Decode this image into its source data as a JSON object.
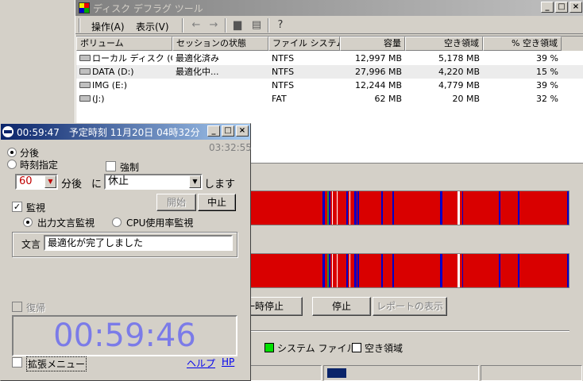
{
  "defrag": {
    "title": "ディスク デフラグ ツール",
    "menu": {
      "action": "操作(A)",
      "view": "表示(V)"
    },
    "columns": {
      "volume": "ボリューム",
      "session": "セッションの状態",
      "filesystem": "ファイル システム",
      "capacity": "容量",
      "free": "空き領域",
      "pct_free": "% 空き領域"
    },
    "volumes": [
      {
        "name": "ローカル ディスク (C:)",
        "status": "最適化済み",
        "fs": "NTFS",
        "capacity": "12,997 MB",
        "free": "5,178 MB",
        "pct": "39 %"
      },
      {
        "name": "DATA (D:)",
        "status": "最適化中...",
        "fs": "NTFS",
        "capacity": "27,996 MB",
        "free": "4,220 MB",
        "pct": "15 %"
      },
      {
        "name": "IMG (E:)",
        "status": "",
        "fs": "NTFS",
        "capacity": "12,244 MB",
        "free": "4,779 MB",
        "pct": "39 %"
      },
      {
        "name": "(J:)",
        "status": "",
        "fs": "FAT",
        "capacity": "62 MB",
        "free": "20 MB",
        "pct": "32 %"
      }
    ],
    "buttons": {
      "pause": "一時停止",
      "stop": "停止",
      "report": "レポートの表示"
    },
    "legend": {
      "system": "システム ファイル",
      "free": "空き領域"
    },
    "colors": {
      "fragmented": "#d90000",
      "contiguous": "#0000c8",
      "unmovable": "#2f8f2f",
      "free": "#ffffff",
      "system": "#00e000"
    }
  },
  "timer": {
    "title": "00:59:47　予定時刻 11月20日 04時32分",
    "elapsed": "03:32:55",
    "mode_after": "分後",
    "mode_time": "時刻指定",
    "force": "強制",
    "minutes": "60",
    "minutes_unit": "分後",
    "ni": "に",
    "action": "休止",
    "shimasu": "します",
    "start": "開始",
    "cancel": "中止",
    "monitor": "監視",
    "monitor_output": "出力文言監視",
    "monitor_cpu": "CPU使用率監視",
    "text_label": "文言",
    "text_value": "最適化が完了しました",
    "restore": "復帰",
    "countdown": "00:59:46",
    "extended_menu": "拡張メニュー",
    "help": "ヘルプ",
    "hp": "HP"
  }
}
